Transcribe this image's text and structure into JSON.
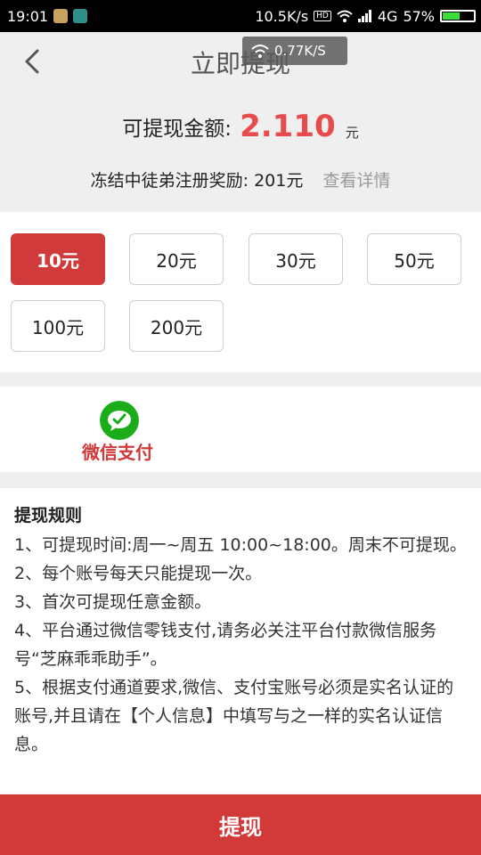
{
  "status_bar": {
    "time": "19:01",
    "net_speed": "10.5K/s",
    "hd": "HD",
    "network": "4G",
    "battery": "57%",
    "battery_level": 0.57
  },
  "speed_overlay": "0.77K/S",
  "header": {
    "title": "立即提现"
  },
  "balance": {
    "label": "可提现金额:",
    "amount": "2.110",
    "unit": "元",
    "frozen_label": "冻结中徒弟注册奖励:",
    "frozen_value": "201元",
    "detail_link": "查看详情"
  },
  "amount_options": [
    {
      "label": "10元",
      "selected": true
    },
    {
      "label": "20元",
      "selected": false
    },
    {
      "label": "30元",
      "selected": false
    },
    {
      "label": "50元",
      "selected": false
    },
    {
      "label": "100元",
      "selected": false
    },
    {
      "label": "200元",
      "selected": false
    }
  ],
  "payment": {
    "method_label": "微信支付",
    "icon": "wechat-pay-icon",
    "color": "#1aad19"
  },
  "rules": {
    "title": "提现规则",
    "items": [
      "1、可提现时间:周一~周五 10:00~18:00。周末不可提现。",
      "2、每个账号每天只能提现一次。",
      "3、首次可提现任意金额。",
      "4、平台通过微信零钱支付,请务必关注平台付款微信服务号“芝麻乖乖助手”。",
      "5、根据支付通道要求,微信、支付宝账号必须是实名认证的账号,并且请在【个人信息】中填写与之一样的实名认证信息。"
    ]
  },
  "submit_label": "提现",
  "colors": {
    "accent": "#d23a3a",
    "amount": "#e74b4b",
    "wechat": "#1aad19"
  }
}
